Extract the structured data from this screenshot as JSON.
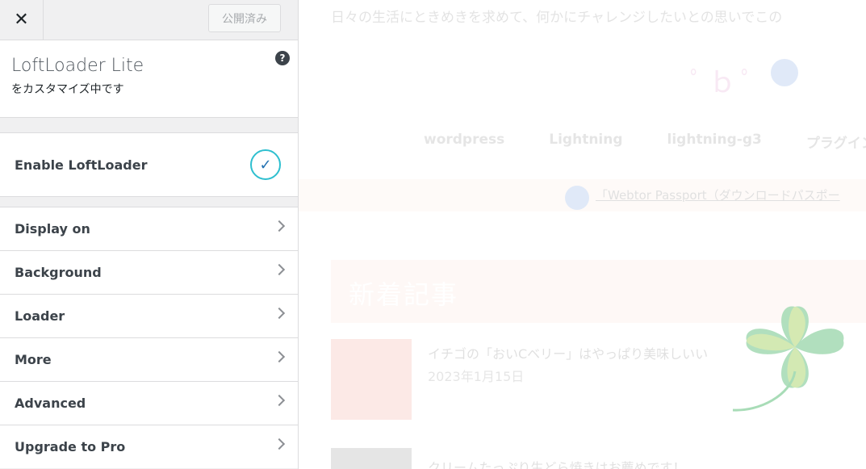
{
  "topbar": {
    "close_glyph": "✕",
    "publish_label": "公開済み"
  },
  "info": {
    "title": "LoftLoader Lite",
    "subtitle": "をカスタマイズ中です",
    "help_glyph": "?"
  },
  "enable": {
    "label": "Enable LoftLoader",
    "checked": true,
    "check_glyph": "✓"
  },
  "sections": [
    {
      "label": "Display on"
    },
    {
      "label": "Background"
    },
    {
      "label": "Loader"
    },
    {
      "label": "More"
    },
    {
      "label": "Advanced"
    },
    {
      "label": "Upgrade to Pro"
    }
  ],
  "preview": {
    "intro": "日々の生活にときめきを求めて、何かにチャレンジしたいとの思いでこの",
    "nav": [
      "wordpress",
      "Lightning",
      "lightning-g3",
      "プラグイン"
    ],
    "notice": "「Webtor Passport（ダウンロードパスポー",
    "heading": "新着記事",
    "posts": [
      {
        "title": "イチゴの「おいCベリー」はやっぱり美味しいい",
        "date": "2023年1月15日"
      },
      {
        "title": "クリームたっぷり生どら焼きはお薦めです！",
        "date": ""
      }
    ]
  },
  "colors": {
    "accent": "#2271b1",
    "check_ring": "#2ebfcf",
    "clover_green": "#a8dcb7",
    "clover_yellow": "#dcebb0"
  }
}
